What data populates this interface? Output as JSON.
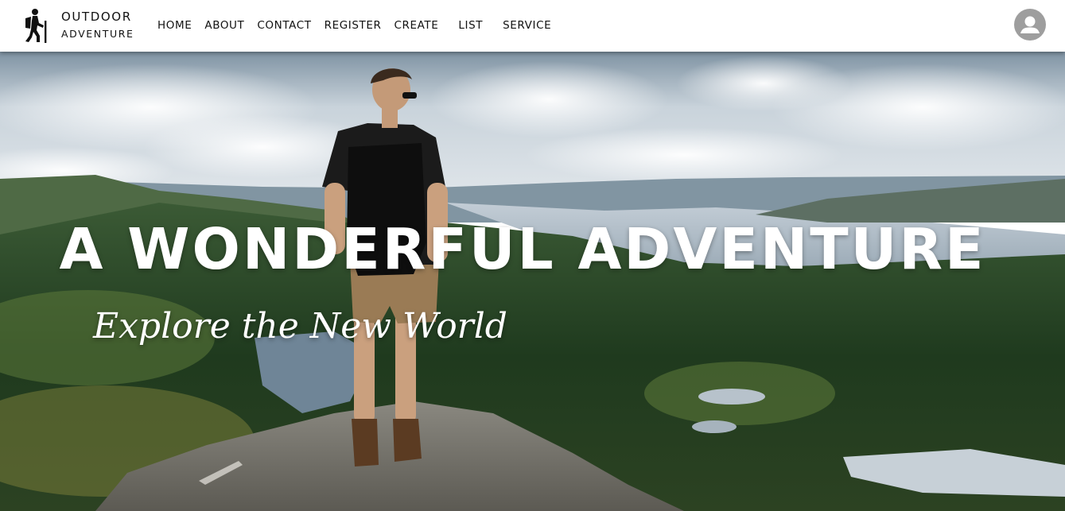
{
  "brand": {
    "line1": "OUTDOOR",
    "line2": "ADVENTURE",
    "logo_icon": "hiker-icon"
  },
  "nav": {
    "items": [
      {
        "label": "HOME"
      },
      {
        "label": "ABOUT"
      },
      {
        "label": "CONTACT"
      },
      {
        "label": "REGISTER"
      },
      {
        "label": "CREATE"
      },
      {
        "label": "LIST"
      },
      {
        "label": "SERVICE"
      }
    ]
  },
  "account": {
    "icon": "user-avatar-icon"
  },
  "hero": {
    "title": "A WONDERFUL ADVENTURE",
    "subtitle": "Explore the New World"
  },
  "colors": {
    "navbar_bg": "#ffffff",
    "nav_text": "#111111",
    "avatar_bg": "#9e9e9e",
    "hero_text": "#ffffff"
  }
}
